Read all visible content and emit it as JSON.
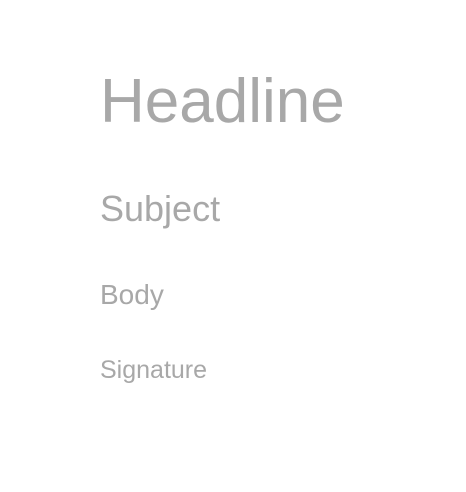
{
  "text_styles": {
    "headline": "Headline",
    "subject": "Subject",
    "body": "Body",
    "signature": "Signature"
  },
  "colors": {
    "text": "#a8a8a8",
    "background": "#ffffff"
  }
}
